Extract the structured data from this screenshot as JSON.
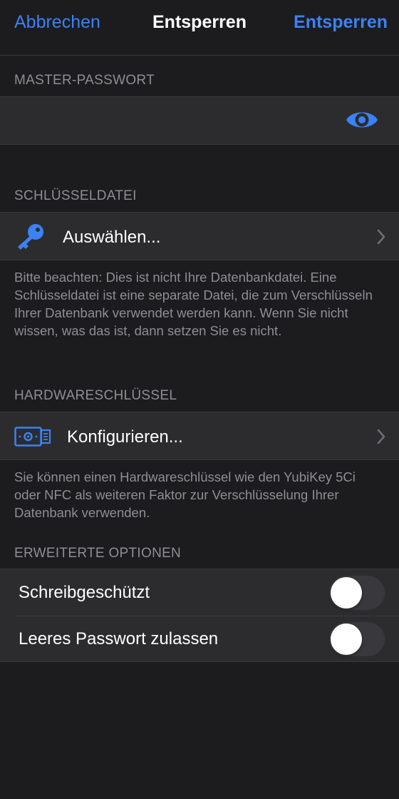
{
  "navbar": {
    "cancel_label": "Abbrechen",
    "title": "Entsperren",
    "unlock_label": "Entsperren"
  },
  "master_password": {
    "header": "MASTER-PASSWORT",
    "value": "",
    "reveal_icon": "eye-icon"
  },
  "keyfile": {
    "header": "SCHLÜSSELDATEI",
    "row_label": "Auswählen...",
    "icon": "key-icon",
    "footer": "Bitte beachten: Dies ist nicht Ihre Datenbankdatei. Eine Schlüsseldatei ist eine separate Datei, die zum Verschlüsseln Ihrer Datenbank verwendet werden kann. Wenn Sie nicht wissen, was das ist, dann setzen Sie es nicht."
  },
  "hardware_key": {
    "header": "HARDWARESCHLÜSSEL",
    "row_label": "Konfigurieren...",
    "icon": "hardware-key-icon",
    "footer": "Sie können einen Hardwareschlüssel wie den YubiKey 5Ci oder NFC als weiteren Faktor zur Verschlüsselung Ihrer Datenbank verwenden."
  },
  "advanced": {
    "header": "ERWEITERTE OPTIONEN",
    "options": [
      {
        "label": "Schreibgeschützt",
        "enabled": false
      },
      {
        "label": "Leeres Passwort zulassen",
        "enabled": false
      }
    ]
  },
  "colors": {
    "accent": "#3b82f6",
    "background": "#1c1c1e",
    "cell": "#2c2c2e",
    "secondary_text": "#8e8e93"
  }
}
